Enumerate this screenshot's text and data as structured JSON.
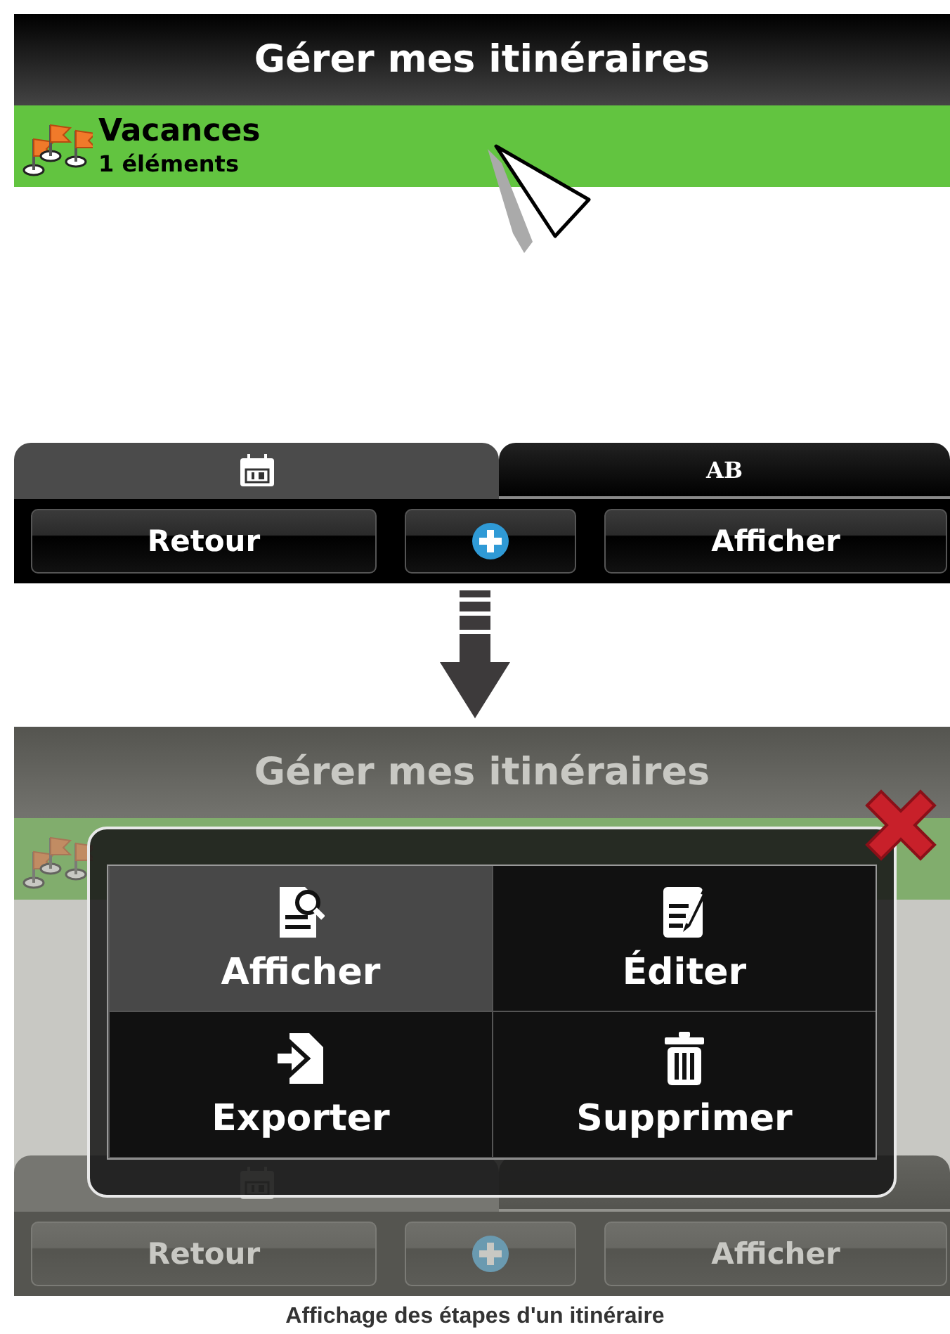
{
  "screens": [
    {
      "dimmed": false,
      "cursor": true,
      "header": {
        "title": "Gérer mes itinéraires"
      },
      "routes": [
        {
          "name": "Vacances",
          "count": "1 éléments",
          "selected": true
        }
      ],
      "tabs": [
        {
          "kind": "calendar",
          "selected": true
        },
        {
          "kind": "text",
          "label": "AB",
          "selected": false
        }
      ],
      "buttons": [
        {
          "kind": "text",
          "label": "Retour"
        },
        {
          "kind": "add"
        },
        {
          "kind": "text",
          "label": "Afficher"
        }
      ]
    },
    {
      "dimmed": true,
      "cursor": false,
      "header": {
        "title": "Gérer mes itinéraires"
      },
      "routes": [
        {
          "selected": true
        }
      ],
      "tabs": [
        {
          "kind": "calendar",
          "selected": true
        },
        {
          "kind": "blank",
          "selected": false
        }
      ],
      "buttons": [
        {
          "kind": "text",
          "label": "Retour"
        },
        {
          "kind": "add"
        },
        {
          "kind": "text",
          "label": "Afficher"
        }
      ],
      "dialog": {
        "items": [
          {
            "kind": "view",
            "label": "Afficher",
            "selected": true
          },
          {
            "kind": "edit",
            "label": "Éditer",
            "selected": false
          },
          {
            "kind": "export",
            "label": "Exporter",
            "selected": false
          },
          {
            "kind": "delete",
            "label": "Supprimer",
            "selected": false
          }
        ]
      }
    }
  ],
  "caption": "Affichage des étapes d'un itinéraire"
}
